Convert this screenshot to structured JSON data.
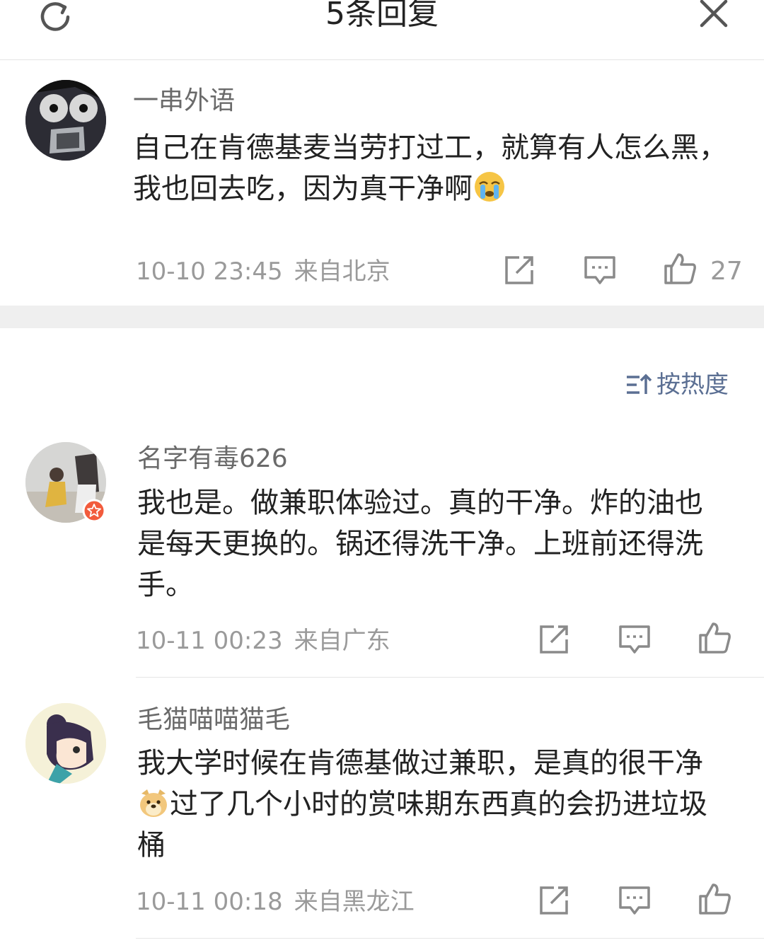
{
  "header": {
    "title": "5条回复",
    "refresh_icon": "refresh-icon",
    "close_icon": "close-icon"
  },
  "main_comment": {
    "username": "一串外语",
    "text": "自己在肯德基麦当劳打过工，就算有人怎么黑，我也回去吃，因为真干净啊",
    "emoji": "crying-emoji",
    "time": "10-10 23:45",
    "location": "来自北京",
    "like_count": "27"
  },
  "sort": {
    "label": "按热度",
    "icon": "sort-icon"
  },
  "replies": [
    {
      "username": "名字有毒626",
      "text": "我也是。做兼职体验过。真的干净。炸的油也是每天更换的。锅还得洗干净。上班前还得洗手。",
      "time": "10-11 00:23",
      "location": "来自广东"
    },
    {
      "username": "毛猫喵喵猫毛",
      "text_before": "我大学时候在肯德基做过兼职，是真的很干净",
      "emoji": "doge-emoji",
      "text_after": "过了几个小时的赏味期东西真的会扔进垃圾桶",
      "time": "10-11 00:18",
      "location": "来自黑龙江"
    }
  ],
  "colors": {
    "accent": "#5b6f93",
    "meta": "#9a9a9a",
    "divider": "#efefef"
  }
}
